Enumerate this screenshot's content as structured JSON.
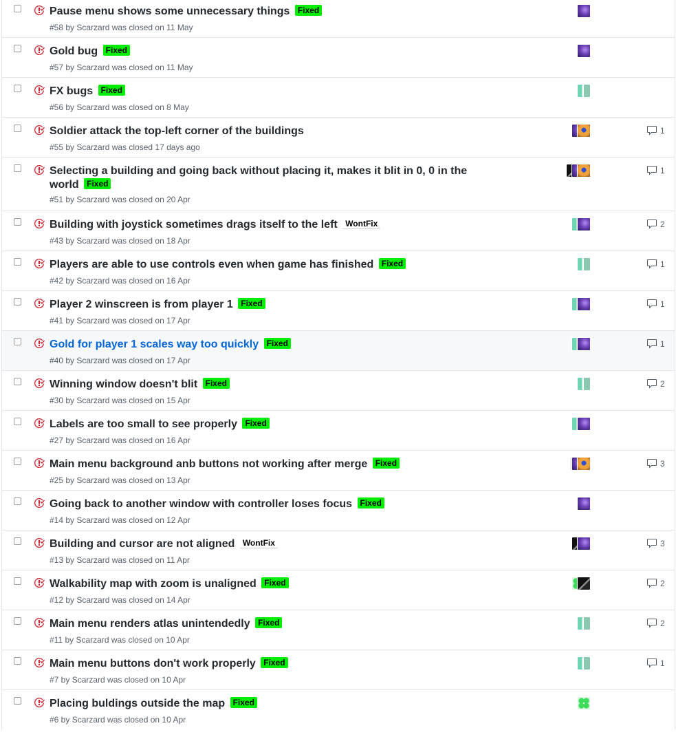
{
  "issues": [
    {
      "title": "Pause menu shows some unnecessary things",
      "labels": [
        "Fixed"
      ],
      "meta": "#58 by Scarzard was closed on 11 May",
      "avatars": [
        "purple"
      ],
      "comments": ""
    },
    {
      "title": "Gold bug",
      "labels": [
        "Fixed"
      ],
      "meta": "#57 by Scarzard was closed on 11 May",
      "avatars": [
        "purple"
      ],
      "comments": ""
    },
    {
      "title": "FX bugs",
      "labels": [
        "Fixed"
      ],
      "meta": "#56 by Scarzard was closed on 8 May",
      "avatars": [
        "teal"
      ],
      "comments": ""
    },
    {
      "title": "Soldier attack the top-left corner of the buildings",
      "labels": [],
      "meta": "#55 by Scarzard was closed 17 days ago",
      "avatars": [
        "purple",
        "orange"
      ],
      "comments": "1"
    },
    {
      "title": "Selecting a building and going back without placing it, makes it blit in 0, 0 in the world",
      "labels": [
        "Fixed"
      ],
      "meta": "#51 by Scarzard was closed on 20 Apr",
      "avatars": [
        "dark",
        "purple",
        "orange"
      ],
      "comments": "1",
      "tall": true
    },
    {
      "title": "Building with joystick sometimes drags itself to the left",
      "labels": [
        "WontFix"
      ],
      "meta": "#43 by Scarzard was closed on 18 Apr",
      "avatars": [
        "teal",
        "purple"
      ],
      "comments": "2"
    },
    {
      "title": "Players are able to use controls even when game has finished",
      "labels": [
        "Fixed"
      ],
      "meta": "#42 by Scarzard was closed on 16 Apr",
      "avatars": [
        "teal"
      ],
      "comments": "1"
    },
    {
      "title": "Player 2 winscreen is from player 1",
      "labels": [
        "Fixed"
      ],
      "meta": "#41 by Scarzard was closed on 17 Apr",
      "avatars": [
        "teal",
        "purple"
      ],
      "comments": "1"
    },
    {
      "title": "Gold for player 1 scales way too quickly",
      "labels": [
        "Fixed"
      ],
      "meta": "#40 by Scarzard was closed on 17 Apr",
      "avatars": [
        "teal",
        "purple"
      ],
      "comments": "1",
      "hover": true
    },
    {
      "title": "Winning window doesn't blit",
      "labels": [
        "Fixed"
      ],
      "meta": "#30 by Scarzard was closed on 15 Apr",
      "avatars": [
        "teal"
      ],
      "comments": "2"
    },
    {
      "title": "Labels are too small to see properly",
      "labels": [
        "Fixed"
      ],
      "meta": "#27 by Scarzard was closed on 16 Apr",
      "avatars": [
        "teal",
        "purple"
      ],
      "comments": ""
    },
    {
      "title": "Main menu background anb buttons not working after merge",
      "labels": [
        "Fixed"
      ],
      "meta": "#25 by Scarzard was closed on 13 Apr",
      "avatars": [
        "light",
        "purple",
        "orange"
      ],
      "comments": "3"
    },
    {
      "title": "Going back to another window with controller loses focus",
      "labels": [
        "Fixed"
      ],
      "meta": "#14 by Scarzard was closed on 12 Apr",
      "avatars": [
        "purple"
      ],
      "comments": ""
    },
    {
      "title": "Building and cursor are not aligned",
      "labels": [
        "WontFix"
      ],
      "meta": "#13 by Scarzard was closed on 11 Apr",
      "avatars": [
        "dark",
        "purple"
      ],
      "comments": "3"
    },
    {
      "title": "Walkability map with zoom is unaligned",
      "labels": [
        "Fixed"
      ],
      "meta": "#12 by Scarzard was closed on 14 Apr",
      "avatars": [
        "green",
        "dark"
      ],
      "comments": "2"
    },
    {
      "title": "Main menu renders atlas unintendedly",
      "labels": [
        "Fixed"
      ],
      "meta": "#11 by Scarzard was closed on 10 Apr",
      "avatars": [
        "teal"
      ],
      "comments": "2"
    },
    {
      "title": "Main menu buttons don't work properly",
      "labels": [
        "Fixed"
      ],
      "meta": "#7 by Scarzard was closed on 10 Apr",
      "avatars": [
        "teal"
      ],
      "comments": "1"
    },
    {
      "title": "Placing buldings outside the map",
      "labels": [
        "Fixed"
      ],
      "meta": "#6 by Scarzard was closed on 10 Apr",
      "avatars": [
        "green"
      ],
      "comments": ""
    }
  ],
  "colors": {
    "closed_icon": "#cb2431",
    "label_fixed": "#00ee00",
    "link_hover": "#0366d6"
  },
  "icons": {
    "closed": "issue-closed-icon",
    "comment": "comment-icon"
  }
}
